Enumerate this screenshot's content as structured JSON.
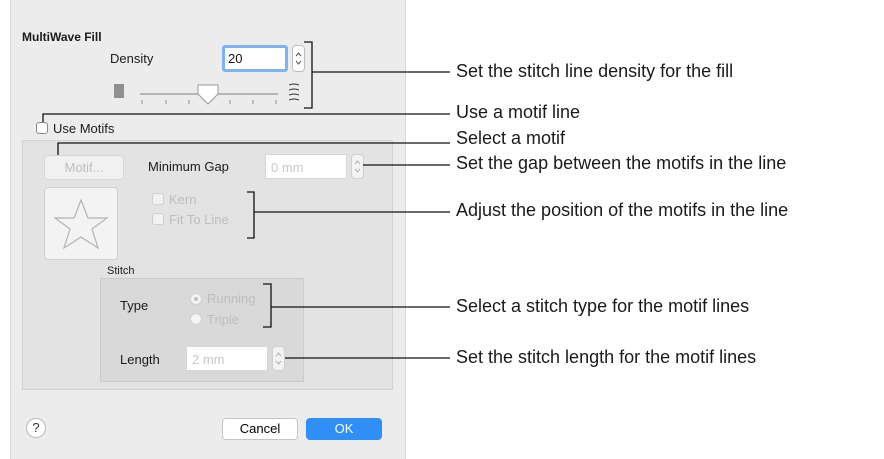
{
  "dialog": {
    "section_title": "MultiWave Fill",
    "density_label": "Density",
    "density_value": "20",
    "use_motifs_label": "Use Motifs",
    "motif_button": "Motif...",
    "minimum_gap_label": "Minimum Gap",
    "minimum_gap_value": "0 mm",
    "kern_label": "Kern",
    "fit_to_line_label": "Fit To Line",
    "stitch_label": "Stitch",
    "type_label": "Type",
    "running_label": "Running",
    "triple_label": "Triple",
    "length_label": "Length",
    "length_value": "2 mm",
    "help_label": "?",
    "cancel_label": "Cancel",
    "ok_label": "OK"
  },
  "density_slider_level": 0.5,
  "annotations": {
    "density": "Set the stitch line density for the fill",
    "use_motif": "Use a motif line",
    "select_motif": "Select a motif",
    "gap": "Set the gap between the motifs in the line",
    "position": "Adjust the position of the motifs in the line",
    "stitch_type": "Select a stitch type for the motif lines",
    "stitch_length": "Set the stitch length for the motif lines"
  },
  "colors": {
    "accent": "#2f8ff7",
    "focus_ring": "#7fb2f0",
    "dialog_bg": "#ececec"
  }
}
